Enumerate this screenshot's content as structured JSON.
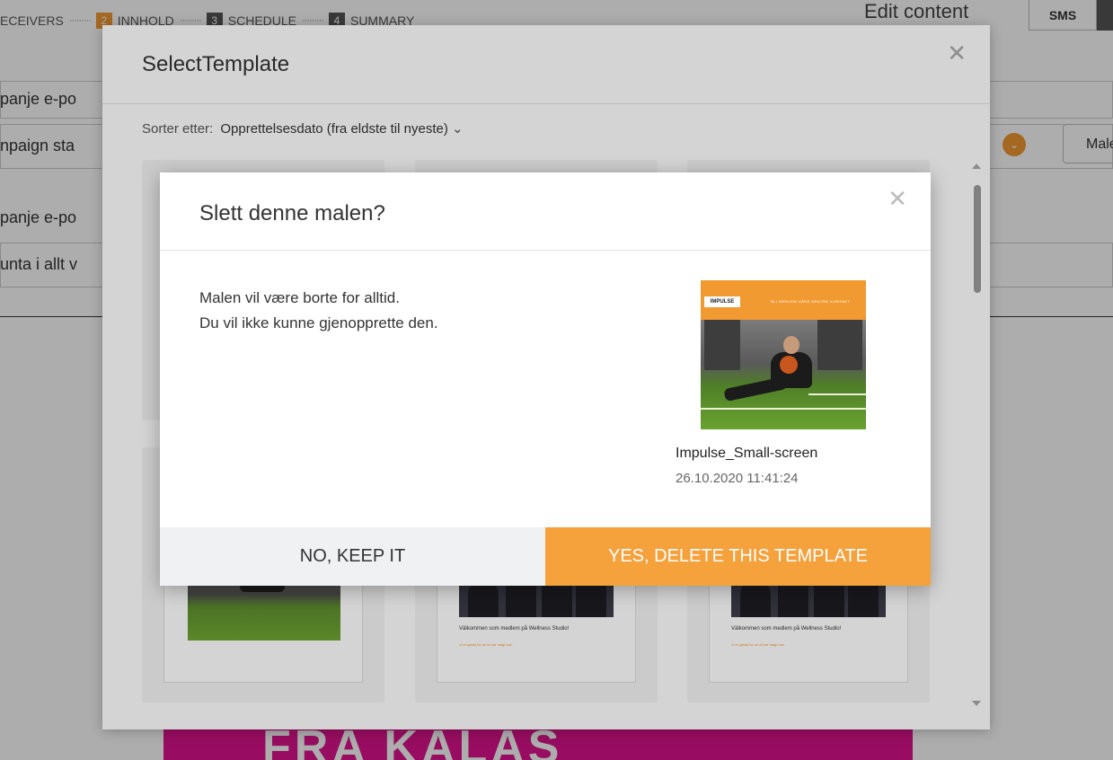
{
  "background": {
    "stepper": [
      {
        "num": "",
        "label": "ECEIVERS"
      },
      {
        "num": "2",
        "label": "INNHOLD"
      },
      {
        "num": "3",
        "label": "SCHEDULE"
      },
      {
        "num": "4",
        "label": "SUMMARY"
      }
    ],
    "edit_content": "Edit content",
    "sms_tab": "SMS",
    "rows": [
      "panje e-po",
      "npaign sta",
      "panje e-po",
      "unta i allt v"
    ],
    "male_button": "Male",
    "banner_text": "FRA KALAS"
  },
  "template_modal": {
    "title": "SelectTemplate",
    "sort_label": "Sorter etter:",
    "sort_value": "Opprettelsesdato (fra eldste til nyeste)",
    "cards": [
      {
        "caption": ""
      },
      {
        "caption": "Välkommen som medlem på Wellness Studio!",
        "sub": "Vi er glade for at du har valgt oss."
      },
      {
        "caption": "Välkommen som medlem på Wellness Studio!",
        "sub": "Vi er glade for at du har valgt oss."
      }
    ]
  },
  "confirm_dialog": {
    "title": "Slett denne malen?",
    "message_line1": "Malen vil være borte for alltid.",
    "message_line2": "Du vil ikke kunne gjenopprette den.",
    "template_name": "Impulse_Small-screen",
    "template_date": "26.10.2020 11:41:24",
    "preview_logo": "IMPULSE",
    "preview_nav": "BLI MEDLEM   VÅRE SENTRE   KONTAKT",
    "cancel_label": "NO, KEEP IT",
    "confirm_label": "YES, DELETE THIS TEMPLATE"
  },
  "colors": {
    "accent": "#f5a13c",
    "cancel_bg": "#f0f1f3",
    "overlay": "rgba(0,0,0,0.35)"
  }
}
